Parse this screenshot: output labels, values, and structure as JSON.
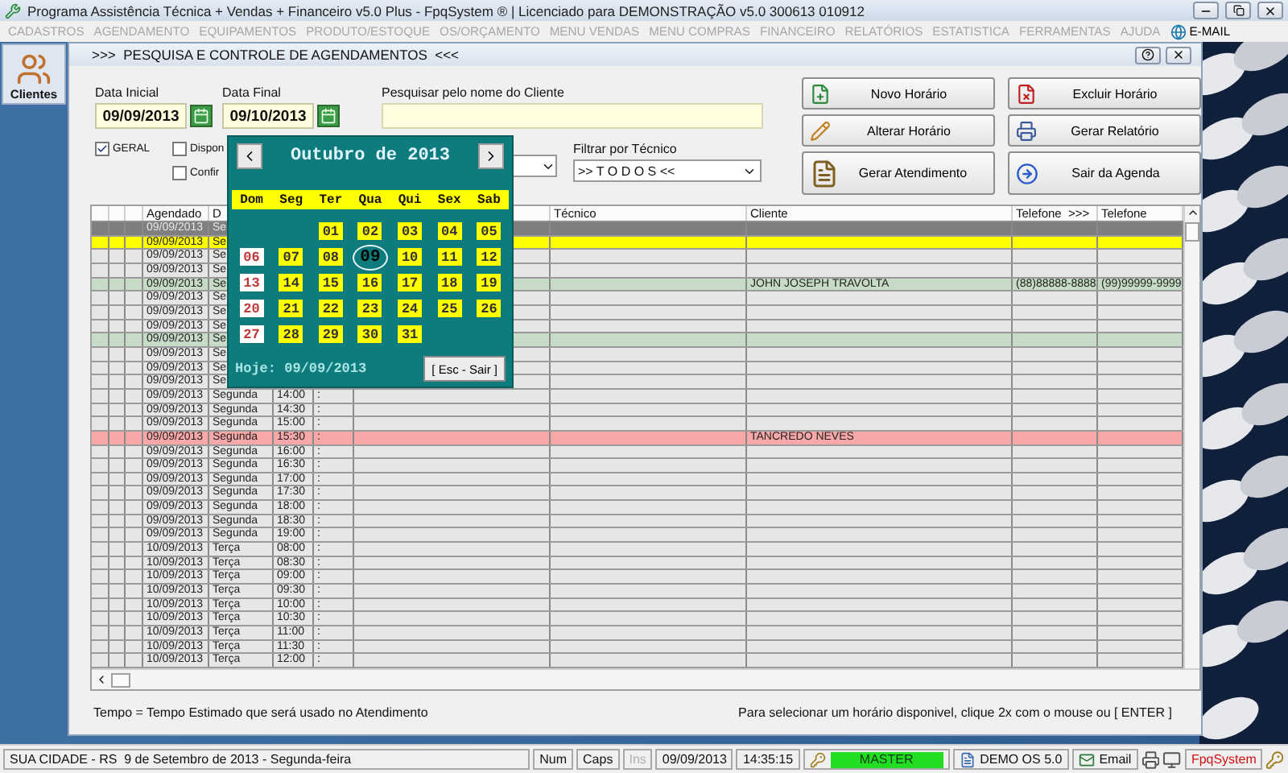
{
  "app": {
    "title": "Programa Assistência Técnica + Vendas + Financeiro v5.0 Plus - FpqSystem ® | Licenciado para  DEMONSTRAÇÃO v5.0 300613 010912"
  },
  "menu": [
    {
      "label": "CADASTROS",
      "disabled": true
    },
    {
      "label": "AGENDAMENTO",
      "disabled": true
    },
    {
      "label": "EQUIPAMENTOS",
      "disabled": true
    },
    {
      "label": "PRODUTO/ESTOQUE",
      "disabled": true
    },
    {
      "label": "OS/ORÇAMENTO",
      "disabled": true
    },
    {
      "label": "MENU VENDAS",
      "disabled": true
    },
    {
      "label": "MENU COMPRAS",
      "disabled": true
    },
    {
      "label": "FINANCEIRO",
      "disabled": true
    },
    {
      "label": "RELATÓRIOS",
      "disabled": true
    },
    {
      "label": "ESTATISTICA",
      "disabled": true
    },
    {
      "label": "FERRAMENTAS",
      "disabled": true
    },
    {
      "label": "AJUDA",
      "disabled": true
    },
    {
      "label": "E-MAIL",
      "disabled": false
    }
  ],
  "sidebar": {
    "items": [
      {
        "label": "Clientes"
      }
    ]
  },
  "window": {
    "title": ">>>  PESQUISA E CONTROLE DE AGENDAMENTOS  <<<"
  },
  "form": {
    "start_date": {
      "label": "Data Inicial",
      "value": "09/09/2013"
    },
    "end_date": {
      "label": "Data Final",
      "value": "09/10/2013"
    },
    "search": {
      "label": "Pesquisar pelo nome do Cliente"
    },
    "filters": [
      {
        "label": "GERAL",
        "checked": true
      },
      {
        "label": "Dispon",
        "checked": false
      },
      {
        "label": "Confir",
        "checked": false
      }
    ],
    "technician": {
      "label": "Filtrar por Técnico",
      "value": ">> T O D O S <<"
    }
  },
  "actions": [
    {
      "label": "Novo Horário"
    },
    {
      "label": "Excluir Horário"
    },
    {
      "label": "Alterar Horário"
    },
    {
      "label": "Gerar Relatório"
    },
    {
      "label": "Gerar Atendimento"
    },
    {
      "label": "Sair da Agenda"
    }
  ],
  "calendar": {
    "month": "Outubro de 2013",
    "weekdays": [
      "Dom",
      "Seg",
      "Ter",
      "Qua",
      "Qui",
      "Sex",
      "Sab"
    ],
    "weeks": [
      [
        {
          "kind": "blank"
        },
        {
          "kind": "blank"
        },
        {
          "label": "01",
          "kind": "weekday",
          "selected": false
        },
        {
          "label": "02",
          "kind": "weekday",
          "selected": false
        },
        {
          "label": "03",
          "kind": "weekday",
          "selected": false
        },
        {
          "label": "04",
          "kind": "weekday",
          "selected": false
        },
        {
          "label": "05",
          "kind": "weekday",
          "selected": false
        }
      ],
      [
        {
          "label": "06",
          "kind": "sunday",
          "selected": false
        },
        {
          "label": "07",
          "kind": "weekday",
          "selected": false
        },
        {
          "label": "08",
          "kind": "weekday",
          "selected": false
        },
        {
          "label": "09",
          "kind": "weekday",
          "selected": true
        },
        {
          "label": "10",
          "kind": "weekday",
          "selected": false
        },
        {
          "label": "11",
          "kind": "weekday",
          "selected": false
        },
        {
          "label": "12",
          "kind": "weekday",
          "selected": false
        }
      ],
      [
        {
          "label": "13",
          "kind": "sunday",
          "selected": false
        },
        {
          "label": "14",
          "kind": "weekday",
          "selected": false
        },
        {
          "label": "15",
          "kind": "weekday",
          "selected": false
        },
        {
          "label": "16",
          "kind": "weekday",
          "selected": false
        },
        {
          "label": "17",
          "kind": "weekday",
          "selected": false
        },
        {
          "label": "18",
          "kind": "weekday",
          "selected": false
        },
        {
          "label": "19",
          "kind": "weekday",
          "selected": false
        }
      ],
      [
        {
          "label": "20",
          "kind": "sunday",
          "selected": false
        },
        {
          "label": "21",
          "kind": "weekday",
          "selected": false
        },
        {
          "label": "22",
          "kind": "weekday",
          "selected": false
        },
        {
          "label": "23",
          "kind": "weekday",
          "selected": false
        },
        {
          "label": "24",
          "kind": "weekday",
          "selected": false
        },
        {
          "label": "25",
          "kind": "weekday",
          "selected": false
        },
        {
          "label": "26",
          "kind": "weekday",
          "selected": false
        }
      ],
      [
        {
          "label": "27",
          "kind": "sunday",
          "selected": false
        },
        {
          "label": "28",
          "kind": "weekday",
          "selected": false
        },
        {
          "label": "29",
          "kind": "weekday",
          "selected": false
        },
        {
          "label": "30",
          "kind": "weekday",
          "selected": false
        },
        {
          "label": "31",
          "kind": "weekday",
          "selected": false
        }
      ]
    ],
    "today": "Hoje: 09/09/2013",
    "close": "[ Esc - Sair ]"
  },
  "table": {
    "columns": [
      {},
      {},
      {},
      {
        "label": "Agendado"
      },
      {
        "label": "D"
      },
      {},
      {},
      {},
      {
        "label": "Técnico"
      },
      {
        "label": "Cliente"
      },
      {
        "label": "Telefone  >>>"
      },
      {
        "label": "Telefone"
      }
    ],
    "rows": [
      {
        "date": "09/09/2013",
        "day": "Se",
        "color": "#7f7f7f",
        "selected": true
      },
      {
        "date": "09/09/2013",
        "day": "Se",
        "color": "#ffff00",
        "selected": false
      },
      {
        "date": "09/09/2013",
        "day": "Se",
        "color": "#e6e6e6",
        "selected": false
      },
      {
        "date": "09/09/2013",
        "day": "Se",
        "color": "#e6e6e6",
        "selected": false
      },
      {
        "date": "09/09/2013",
        "day": "Se",
        "color": "#c6dcc6",
        "selected": false,
        "client": "JOHN JOSEPH TRAVOLTA",
        "phone": "(88)88888-8888",
        "phone_2": "(99)99999-9999"
      },
      {
        "date": "09/09/2013",
        "day": "Se",
        "color": "#e6e6e6",
        "selected": false
      },
      {
        "date": "09/09/2013",
        "day": "Se",
        "color": "#e6e6e6",
        "selected": false
      },
      {
        "date": "09/09/2013",
        "day": "Se",
        "color": "#e6e6e6",
        "selected": false
      },
      {
        "date": "09/09/2013",
        "day": "Se",
        "color": "#c6dcc6",
        "selected": false
      },
      {
        "date": "09/09/2013",
        "day": "Se",
        "color": "#e6e6e6",
        "selected": false
      },
      {
        "date": "09/09/2013",
        "day": "Se",
        "color": "#e6e6e6",
        "selected": false
      },
      {
        "date": "09/09/2013",
        "day": "Se",
        "color": "#e6e6e6",
        "selected": false
      },
      {
        "date": "09/09/2013",
        "day": "Segunda",
        "time": "14:00",
        "sep": ":",
        "color": "#e6e6e6",
        "selected": false
      },
      {
        "date": "09/09/2013",
        "day": "Segunda",
        "time": "14:30",
        "sep": ":",
        "color": "#e6e6e6",
        "selected": false
      },
      {
        "date": "09/09/2013",
        "day": "Segunda",
        "time": "15:00",
        "sep": ":",
        "color": "#e6e6e6",
        "selected": false
      },
      {
        "date": "09/09/2013",
        "day": "Segunda",
        "time": "15:30",
        "sep": ":",
        "color": "#f8a8a8",
        "selected": false,
        "client": "TANCREDO NEVES"
      },
      {
        "date": "09/09/2013",
        "day": "Segunda",
        "time": "16:00",
        "sep": ":",
        "color": "#e6e6e6",
        "selected": false
      },
      {
        "date": "09/09/2013",
        "day": "Segunda",
        "time": "16:30",
        "sep": ":",
        "color": "#e6e6e6",
        "selected": false
      },
      {
        "date": "09/09/2013",
        "day": "Segunda",
        "time": "17:00",
        "sep": ":",
        "color": "#e6e6e6",
        "selected": false
      },
      {
        "date": "09/09/2013",
        "day": "Segunda",
        "time": "17:30",
        "sep": ":",
        "color": "#e6e6e6",
        "selected": false
      },
      {
        "date": "09/09/2013",
        "day": "Segunda",
        "time": "18:00",
        "sep": ":",
        "color": "#e6e6e6",
        "selected": false
      },
      {
        "date": "09/09/2013",
        "day": "Segunda",
        "time": "18:30",
        "sep": ":",
        "color": "#e6e6e6",
        "selected": false
      },
      {
        "date": "09/09/2013",
        "day": "Segunda",
        "time": "19:00",
        "sep": ":",
        "color": "#e6e6e6",
        "selected": false
      },
      {
        "date": "10/09/2013",
        "day": "Terça",
        "time": "08:00",
        "sep": ":",
        "color": "#e6e6e6",
        "selected": false
      },
      {
        "date": "10/09/2013",
        "day": "Terça",
        "time": "08:30",
        "sep": ":",
        "color": "#e6e6e6",
        "selected": false
      },
      {
        "date": "10/09/2013",
        "day": "Terça",
        "time": "09:00",
        "sep": ":",
        "color": "#e6e6e6",
        "selected": false
      },
      {
        "date": "10/09/2013",
        "day": "Terça",
        "time": "09:30",
        "sep": ":",
        "color": "#e6e6e6",
        "selected": false
      },
      {
        "date": "10/09/2013",
        "day": "Terça",
        "time": "10:00",
        "sep": ":",
        "color": "#e6e6e6",
        "selected": false
      },
      {
        "date": "10/09/2013",
        "day": "Terça",
        "time": "10:30",
        "sep": ":",
        "color": "#e6e6e6",
        "selected": false
      },
      {
        "date": "10/09/2013",
        "day": "Terça",
        "time": "11:00",
        "sep": ":",
        "color": "#e6e6e6",
        "selected": false
      },
      {
        "date": "10/09/2013",
        "day": "Terça",
        "time": "11:30",
        "sep": ":",
        "color": "#e6e6e6",
        "selected": false
      },
      {
        "date": "10/09/2013",
        "day": "Terça",
        "time": "12:00",
        "sep": ":",
        "color": "#e6e6e6",
        "selected": false
      }
    ]
  },
  "notes": [
    "Tempo = Tempo Estimado que será usado no Atendimento",
    "Para selecionar um horário disponivel, clique 2x com o mouse ou [ ENTER ]"
  ],
  "status_bar": {
    "items": [
      {
        "text": "SUA CIDADE - RS  9 de Setembro de 2013 - Segunda-feira",
        "kind": "wide"
      },
      {
        "text": "Num",
        "kind": "plain"
      },
      {
        "text": "Caps",
        "kind": "plain"
      },
      {
        "text": "Ins",
        "kind": "dim"
      },
      {
        "text": "09/09/2013",
        "kind": "plain"
      },
      {
        "text": "14:35:15",
        "kind": "plain"
      },
      {
        "text": "MASTER",
        "kind": "user"
      },
      {
        "text": "DEMO OS 5.0",
        "kind": "app"
      },
      {
        "text": "Email",
        "kind": "mail"
      },
      {
        "kind": "printer"
      },
      {
        "kind": "monitor"
      },
      {
        "text": "FpqSystem",
        "kind": "brand"
      },
      {
        "kind": "keys"
      }
    ]
  }
}
